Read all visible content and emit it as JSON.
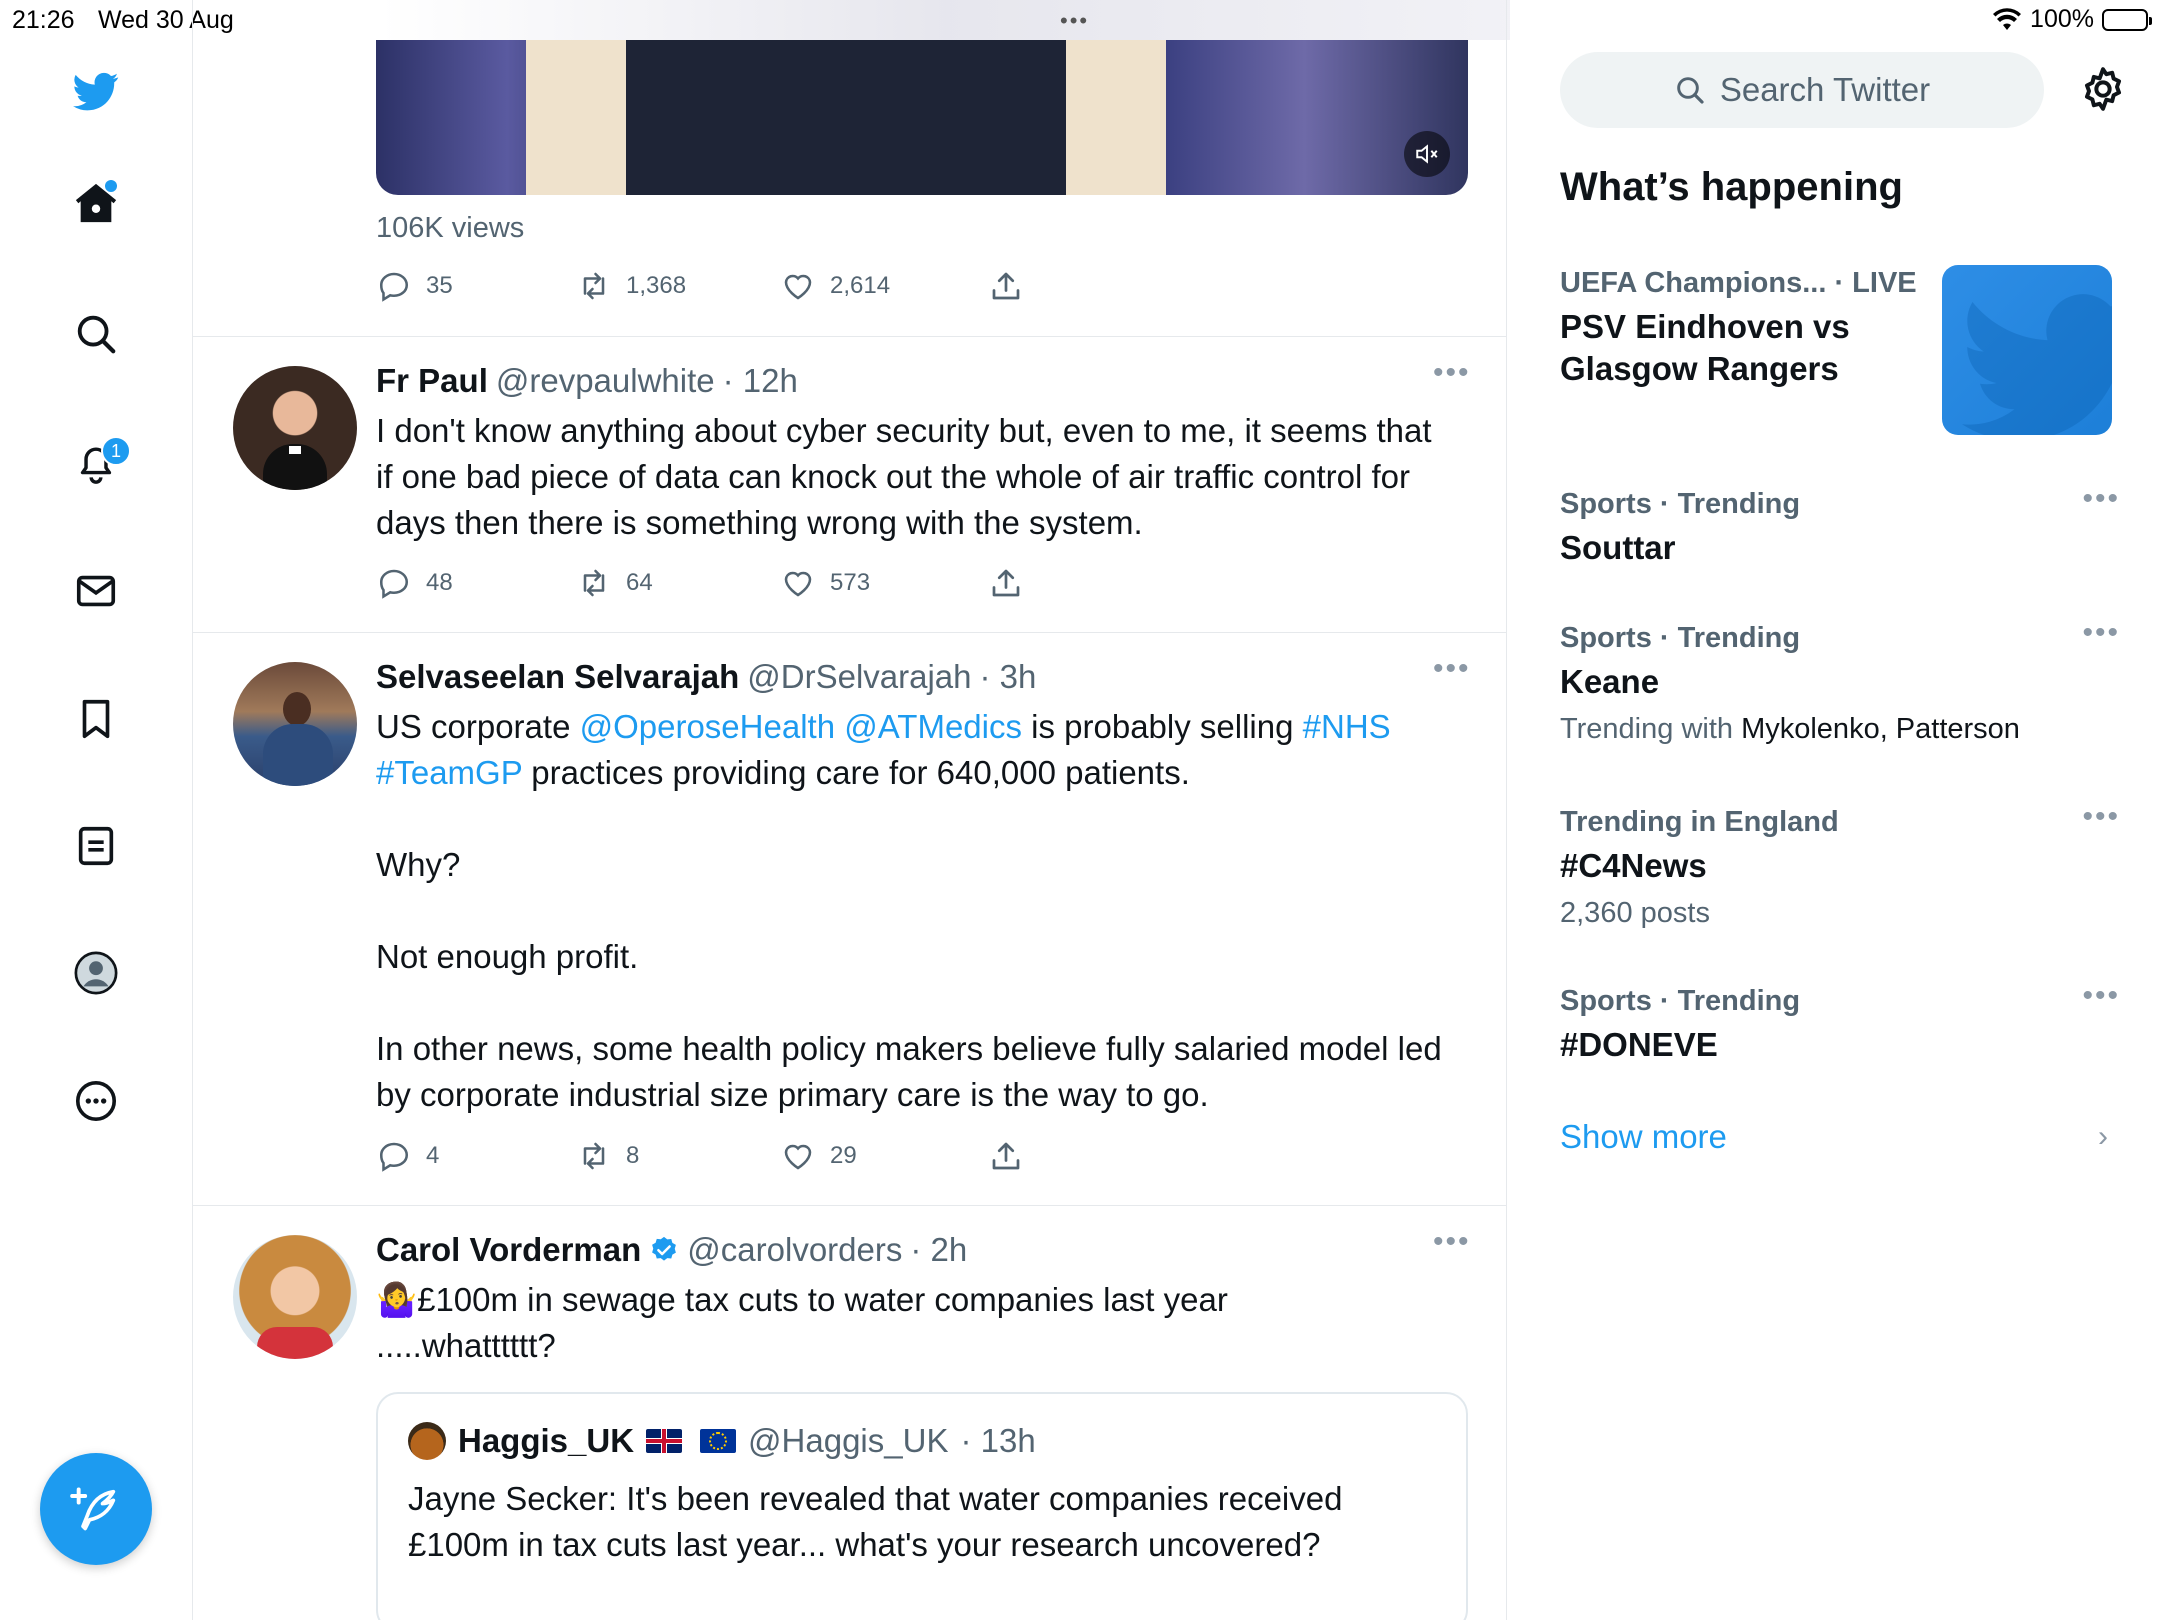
{
  "status_bar": {
    "time": "21:26",
    "date": "Wed 30 Aug",
    "battery": "100%"
  },
  "nav": {
    "notifications_badge": "1"
  },
  "top_tweet": {
    "views": "106K views",
    "replies": "35",
    "retweets": "1,368",
    "likes": "2,614"
  },
  "tweets": [
    {
      "name": "Fr Paul",
      "handle": "@revpaulwhite",
      "time": "· 12h",
      "text": "I don't know anything about cyber security but, even to me, it seems that if one bad piece of data can knock out the whole of air traffic control for days then there is something wrong with the system.",
      "replies": "48",
      "retweets": "64",
      "likes": "573"
    },
    {
      "name": "Selvaseelan Selvarajah",
      "handle": "@DrSelvarajah",
      "time": "· 3h",
      "text_parts": {
        "p1": "US corporate ",
        "link1": "@OperoseHealth",
        "link2": "@ATMedics",
        "p2": " is probably selling ",
        "link3": "#NHS",
        "link4": "#TeamGP",
        "p3": " practices providing care for 640,000 patients.",
        "p4": "Why?",
        "p5": "Not enough profit.",
        "p6": "In other news, some health policy makers believe fully salaried model led by corporate industrial size primary care is the way to go."
      },
      "replies": "4",
      "retweets": "8",
      "likes": "29"
    },
    {
      "name": "Carol Vorderman",
      "handle": "@carolvorders",
      "time": "· 2h",
      "emoji": "🤷‍♀️",
      "text": "£100m in sewage tax cuts to water companies last year .....whatttttt?",
      "quote": {
        "name": "Haggis_UK",
        "handle": "@Haggis_UK",
        "time": "· 13h",
        "text": "Jayne Secker: It's been revealed that water companies received £100m in tax cuts last year... what's your research uncovered?"
      }
    }
  ],
  "sidebar": {
    "search_placeholder": "Search Twitter",
    "heading": "What’s happening",
    "trends": [
      {
        "meta": "UEFA Champions... · LIVE",
        "title": "PSV Eindhoven vs Glasgow Rangers"
      },
      {
        "meta": "Sports · Trending",
        "title": "Souttar"
      },
      {
        "meta": "Sports · Trending",
        "title": "Keane",
        "sub_prefix": "Trending with ",
        "sub_names": "Mykolenko, Patterson"
      },
      {
        "meta": "Trending in England",
        "title": "#C4News",
        "sub": "2,360 posts"
      },
      {
        "meta": "Sports · Trending",
        "title": "#DONEVE"
      }
    ],
    "show_more": "Show more"
  },
  "colors": {
    "accent": "#1d9bf0",
    "secondary_text": "#536471"
  }
}
